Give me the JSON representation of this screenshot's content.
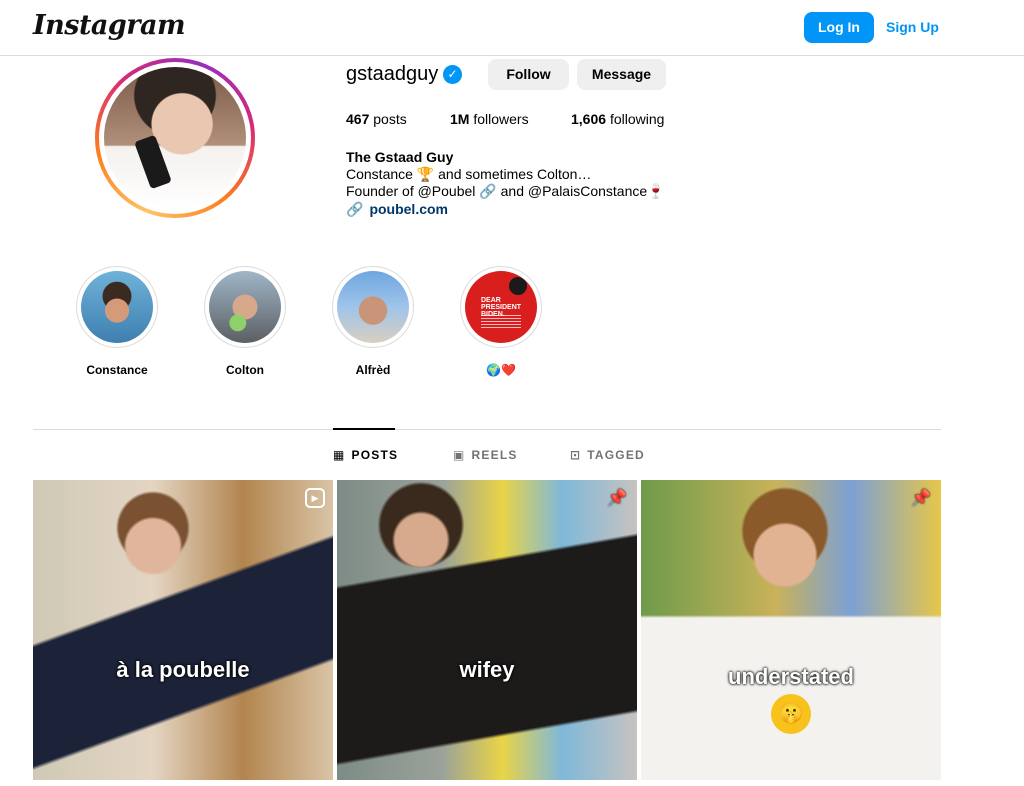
{
  "header": {
    "logo_text": "Instagram",
    "login_label": "Log In",
    "signup_label": "Sign Up"
  },
  "profile": {
    "username": "gstaadguy",
    "verified": true,
    "verified_glyph": "✓",
    "follow_label": "Follow",
    "message_label": "Message",
    "stats": {
      "posts_count": "467",
      "posts_label": "posts",
      "followers_count": "1M",
      "followers_label": "followers",
      "following_count": "1,606",
      "following_label": "following"
    },
    "full_name": "The Gstaad Guy",
    "bio_lines": [
      "Constance 🏆 and sometimes Colton…",
      "Founder of @Poubel 🔗 and @PalaisConstance🍷"
    ],
    "link_icon": "🔗",
    "link_text": "poubel.com"
  },
  "highlights": [
    {
      "label": "Constance",
      "image": "sea-portrait"
    },
    {
      "label": "Colton",
      "image": "car-portrait"
    },
    {
      "label": "Alfrèd",
      "image": "beach-portrait"
    },
    {
      "label": "🌍❤️",
      "image": "red-letter",
      "image_text": "DEAR PRESIDENT BIDEN."
    }
  ],
  "tabs": [
    {
      "label": "POSTS",
      "icon": "grid-icon",
      "glyph": "▦",
      "active": true
    },
    {
      "label": "REELS",
      "icon": "reels-icon",
      "glyph": "▣",
      "active": false
    },
    {
      "label": "TAGGED",
      "icon": "tagged-icon",
      "glyph": "⊡",
      "active": false
    }
  ],
  "posts": [
    {
      "caption": "à la poubelle",
      "badge": "reel-icon",
      "badge_glyph": "▶"
    },
    {
      "caption": "wifey",
      "badge": "pin-icon",
      "badge_glyph": "📌"
    },
    {
      "caption": "understated",
      "badge": "pin-icon",
      "badge_glyph": "📌",
      "emoji": "🤫"
    }
  ],
  "colors": {
    "accent": "#0095f6",
    "link": "#00376b",
    "border": "#dbdbdb"
  }
}
